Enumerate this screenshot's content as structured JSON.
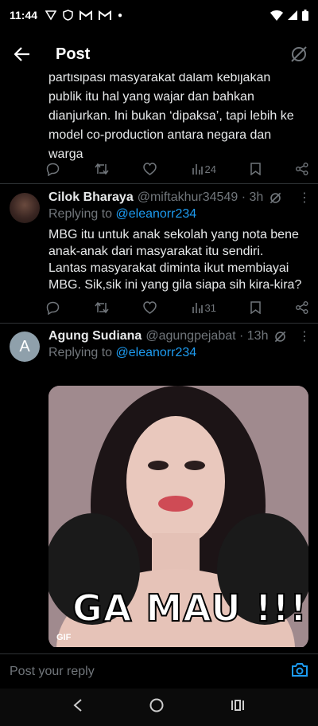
{
  "status_bar": {
    "time": "11:44"
  },
  "app_bar": {
    "title": "Post"
  },
  "partial_tweet": {
    "text": "partisipasi masyarakat dalam kebijakan publik itu hal yang wajar dan bahkan dianjurkan. Ini bukan ‘dipaksa’, tapi lebih ke model co-production antara negara dan warga",
    "views": "24"
  },
  "tweets": [
    {
      "name": "Cilok Bharaya",
      "handle": "@miftakhur34549 · 3h",
      "replying_prefix": "Replying to ",
      "replying_to": "@eleanorr234",
      "text": "MBG itu untuk anak sekolah yang nota bene anak-anak dari masyarakat itu sendiri. Lantas masyarakat diminta ikut membiayai MBG. Sik,sik ini yang gila siapa sih kira-kira?",
      "views": "31"
    },
    {
      "name": "Agung Sudiana",
      "handle": "@agungpejabat · 13h",
      "replying_prefix": "Replying to ",
      "replying_to": "@eleanorr234",
      "avatar_letter": "A",
      "gif_caption": "GA MAU !!!",
      "gif_badge": "GIF"
    }
  ],
  "reply_bar": {
    "placeholder": "Post your reply"
  },
  "colors": {
    "accent": "#1d9bf0",
    "muted": "#71767b",
    "background": "#000000"
  }
}
